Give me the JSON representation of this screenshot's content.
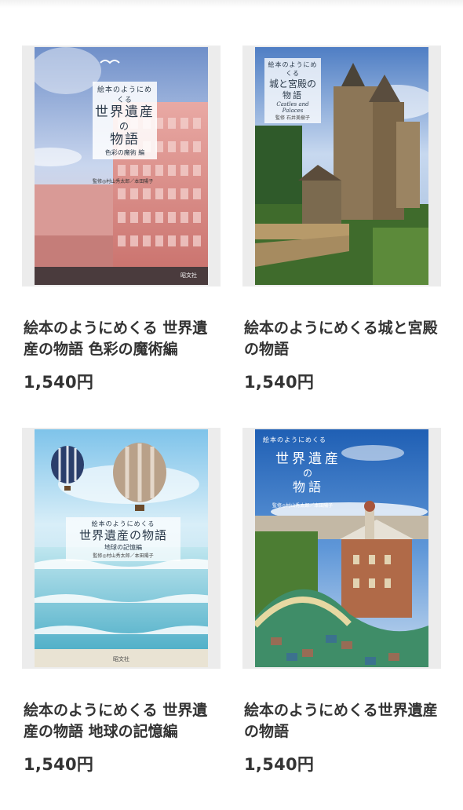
{
  "products": [
    {
      "title": "絵本のようにめくる 世界遺産の物語 色彩の魔術編",
      "price": "1,540円",
      "cover": {
        "kicker": "絵本のようにめくる",
        "headline_1": "世界遺産",
        "headline_2": "の",
        "headline_3": "物語",
        "subtitle": "色彩の魔術 編",
        "credit": "監修◎村山秀太郎／本田陽子",
        "publisher": "昭文社"
      }
    },
    {
      "title": "絵本のようにめくる城と宮殿の物語",
      "price": "1,540円",
      "cover": {
        "kicker": "絵本のようにめくる",
        "headline_1": "城と宮殿の",
        "headline_2": "物語",
        "english": "Castles and Palaces",
        "credit": "監修 石井美樹子"
      }
    },
    {
      "title": "絵本のようにめくる 世界遺産の物語 地球の記憶編",
      "price": "1,540円",
      "cover": {
        "kicker": "絵本のようにめくる",
        "headline_1": "世界遺産の物語",
        "subtitle": "地球の記憶編",
        "credit": "監修◎村山秀太郎／本田陽子",
        "publisher": "昭文社"
      }
    },
    {
      "title": "絵本のようにめくる世界遺産の物語",
      "price": "1,540円",
      "cover": {
        "kicker": "絵本のようにめくる",
        "headline_1": "世界遺産",
        "headline_2": "の",
        "headline_3": "物語",
        "credit": "監修◎村山秀太郎／本田陽子"
      }
    }
  ],
  "colors": {
    "text": "#333333",
    "frame": "#ececec"
  }
}
